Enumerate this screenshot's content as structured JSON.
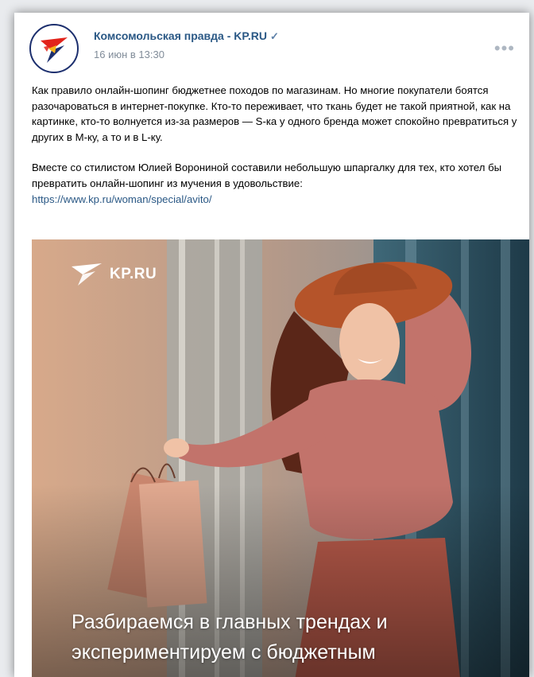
{
  "post": {
    "author": "Комсомольская правда - KP.RU",
    "verified_icon": "✓",
    "date": "16 июн в 13:30",
    "more_icon": "•••",
    "paragraph1": "Как правило онлайн-шопинг бюджетнее походов по магазинам. Но многие покупатели боятся разочароваться в интернет-покупке. Кто-то переживает, что ткань будет не такой приятной, как на картинке, кто-то волнуется из-за размеров — S-ка у одного бренда может спокойно превратиться у других в М-ку, а то и в L-ку.",
    "paragraph2": "Вместе со стилистом Юлией Ворониной составили небольшую шпаргалку для тех, кто хотел бы превратить онлайн-шопинг из мучения в удовольствие:",
    "link": "https://www.kp.ru/woman/special/avito/"
  },
  "photo": {
    "logo_text": "KP.RU",
    "caption_line1": "Разбираемся в главных трендах и",
    "caption_line2": "экспериментируем с бюджетным"
  },
  "colors": {
    "brand_blue": "#2a5885",
    "logo_red": "#e2231a",
    "logo_navy": "#1c2f6e",
    "sweater": "#c2736b"
  }
}
